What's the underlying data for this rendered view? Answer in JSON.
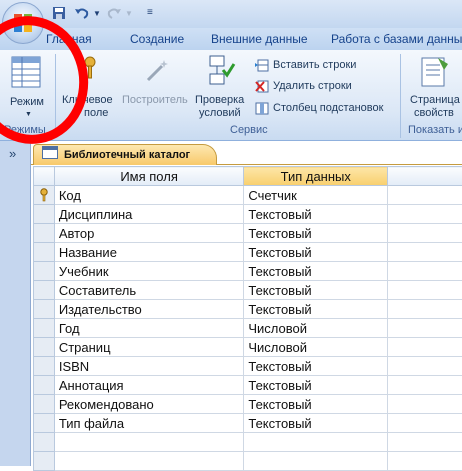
{
  "tabs": [
    "Главная",
    "Создание",
    "Внешние данные",
    "Работа с базами данных"
  ],
  "ribbon": {
    "mode_label": "Режим",
    "mode_group": "Режимы",
    "key_label_1": "Ключевое",
    "key_label_2": "поле",
    "builder_label": "Построитель",
    "check_label_1": "Проверка",
    "check_label_2": "условий",
    "insert_rows": "Вставить строки",
    "delete_rows": "Удалить строки",
    "lookup_column": "Столбец  подстановок",
    "service_group": "Сервис",
    "props_label_1": "Страница",
    "props_label_2": "свойств",
    "show_group": "Показать и"
  },
  "nav": {
    "toggle": "»"
  },
  "document": {
    "title": "Библиотечный каталог"
  },
  "table": {
    "columns": [
      "Имя поля",
      "Тип данных"
    ],
    "rows": [
      {
        "name": "Код",
        "type": "Счетчик",
        "key": true
      },
      {
        "name": "Дисциплина",
        "type": "Текстовый"
      },
      {
        "name": "Автор",
        "type": "Текстовый"
      },
      {
        "name": "Название",
        "type": "Текстовый"
      },
      {
        "name": "Учебник",
        "type": "Текстовый"
      },
      {
        "name": "Составитель",
        "type": "Текстовый"
      },
      {
        "name": "Издательство",
        "type": "Текстовый"
      },
      {
        "name": "Год",
        "type": "Числовой"
      },
      {
        "name": "Страниц",
        "type": "Числовой"
      },
      {
        "name": "ISBN",
        "type": "Текстовый"
      },
      {
        "name": "Аннотация",
        "type": "Текстовый"
      },
      {
        "name": "Рекомендовано",
        "type": "Текстовый"
      },
      {
        "name": "Тип файла",
        "type": "Текстовый"
      },
      {
        "name": "",
        "type": ""
      },
      {
        "name": "",
        "type": ""
      }
    ]
  },
  "colors": {
    "annotation": "#ff0000",
    "selected_header": "#f8cf6e",
    "ribbon": "#dbe7f6"
  }
}
